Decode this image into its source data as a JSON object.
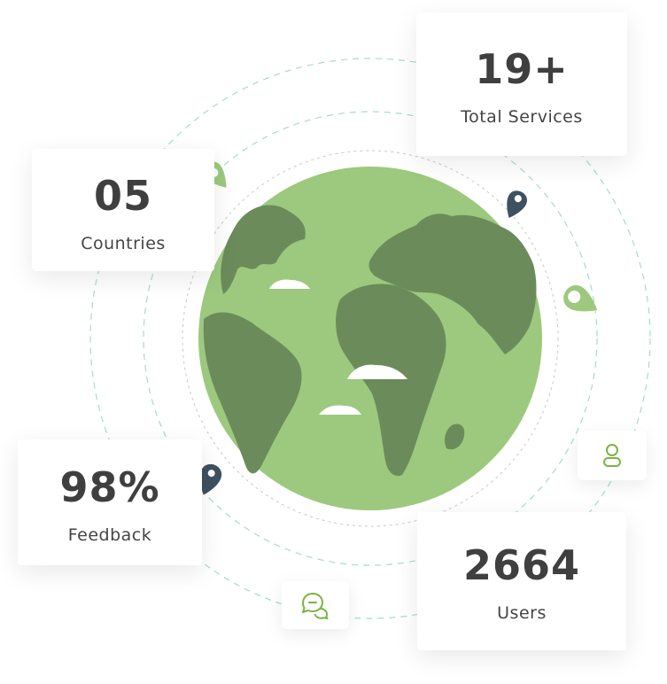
{
  "stats": {
    "services": {
      "value": "19+",
      "label": "Total Services"
    },
    "countries": {
      "value": "05",
      "label": "Countries"
    },
    "feedback": {
      "value": "98%",
      "label": "Feedback"
    },
    "users": {
      "value": "2664",
      "label": "Users"
    }
  },
  "colors": {
    "globe_ocean": "#9cc97e",
    "globe_land": "#6b8c5a",
    "accent_green": "#7cb342",
    "pin_dark": "#3e5160",
    "ring_dash": "#a8dcc8",
    "text_dark": "#3f3f3f"
  },
  "icons": {
    "user": "user-icon",
    "chat": "chat-bubbles-icon",
    "pin": "map-pin-icon"
  }
}
